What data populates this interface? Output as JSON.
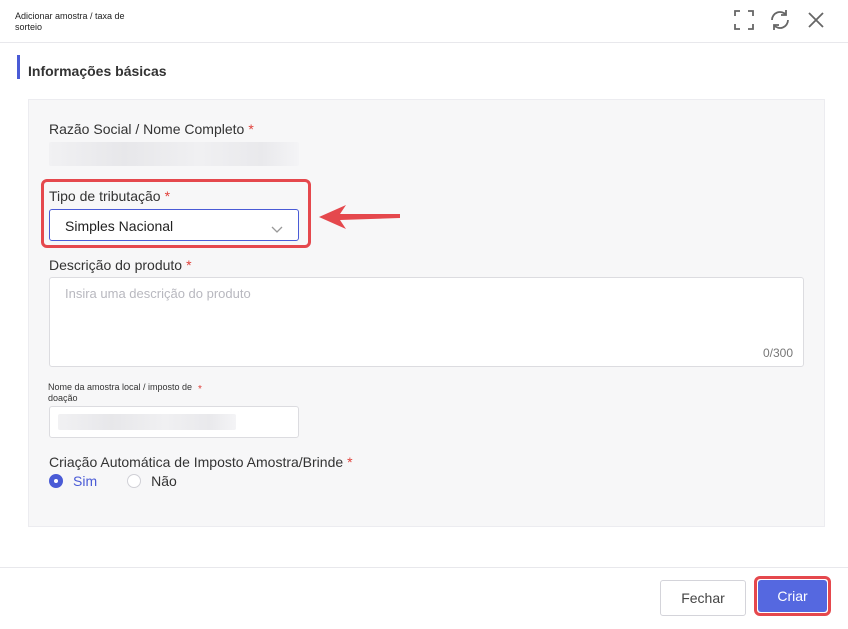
{
  "dialog": {
    "title": "Adicionar amostra / taxa de sorteio",
    "icons": [
      "fullscreen-icon",
      "refresh-icon",
      "close-icon"
    ]
  },
  "section": {
    "title": "Informações básicas"
  },
  "form": {
    "company_name": {
      "label": "Razão Social / Nome Completo",
      "required_mark": "*"
    },
    "tax_type": {
      "label": "Tipo de tributação",
      "required_mark": "*",
      "value": "Simples Nacional"
    },
    "product_description": {
      "label": "Descrição do produto",
      "required_mark": "*",
      "placeholder": "Insira uma descrição do produto",
      "counter": "0/300"
    },
    "local_sample_name": {
      "label": "Nome da amostra local / imposto de doação",
      "required_mark": "*"
    },
    "auto_tax_creation": {
      "label": "Criação Automática de Imposto Amostra/Brinde",
      "required_mark": "*",
      "options": [
        "Sim",
        "Não"
      ],
      "selected": "Sim"
    }
  },
  "footer": {
    "close_label": "Fechar",
    "create_label": "Criar"
  },
  "colors": {
    "accent": "#4a5bd6",
    "primary_button": "#5568e0",
    "required": "#e0403a",
    "annotation": "#e5484d"
  }
}
